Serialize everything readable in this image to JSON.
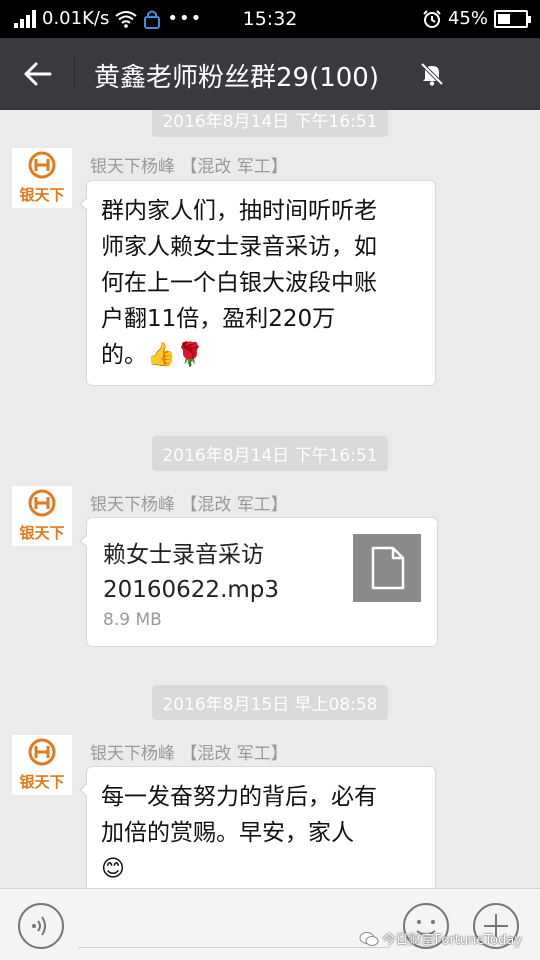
{
  "status_bar": {
    "network_speed": "0.01K/s",
    "time": "15:32",
    "battery_percent_text": "45%",
    "battery_level": 0.45
  },
  "header": {
    "title": "黄鑫老师粉丝群29(100)",
    "back_icon": "back-arrow-icon",
    "mute_icon": "bell-muted-icon"
  },
  "messages": [
    {
      "timestamp": "2016年8月14日 下午16:51",
      "sender": "银天下杨峰 【混改 军工】",
      "avatar_text": "银天下",
      "lines": [
        "群内家人们，抽时间听听老",
        "师家人赖女士录音采访，如",
        "何在上一个白银大波段中账",
        "户翻11倍，盈利220万",
        "的。👍🌹"
      ]
    },
    {
      "timestamp": "2016年8月14日 下午16:51",
      "sender": "银天下杨峰 【混改 军工】",
      "avatar_text": "银天下",
      "file_name_line1": "赖女士录音采访",
      "file_name_line2": "20160622.mp3",
      "file_size": "8.9 MB",
      "file_icon": "document-icon"
    },
    {
      "timestamp": "2016年8月15日 早上08:58",
      "sender": "银天下杨峰 【混改 军工】",
      "avatar_text": "银天下",
      "lines": [
        "每一发奋努力的背后，必有",
        "加倍的赏赐。早安，家人",
        "😊"
      ]
    }
  ],
  "input_bar": {
    "voice_icon": "voice-icon",
    "emoji_icon": "emoji-icon",
    "plus_icon": "plus-icon"
  },
  "watermark": "今日财富FortuneToday",
  "colors": {
    "header_bg": "#393a3f",
    "chat_bg": "#ebebeb",
    "avatar_orange": "#e07a1a"
  }
}
